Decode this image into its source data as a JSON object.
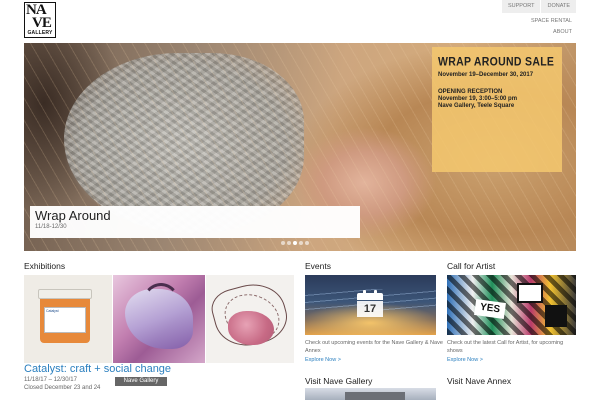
{
  "header": {
    "logo": {
      "big_top": "NA",
      "big_bottom": "VE",
      "small": "GALLERY"
    },
    "nav": {
      "support": "SUPPORT",
      "donate": "DONATE",
      "space_rental": "SPACE RENTAL",
      "about": "ABOUT"
    }
  },
  "hero": {
    "sale": {
      "title": "WRAP AROUND SALE",
      "dates": "November 19–December 30, 2017",
      "reception_heading": "OPENING RECEPTION",
      "reception_time": "November 19, 3:00–5:00 pm",
      "reception_place": "Nave Gallery, Teele Square"
    },
    "caption": {
      "title": "Wrap Around",
      "dates": "11/18-12/30"
    },
    "slides": 5,
    "active_slide": 3
  },
  "exhibitions": {
    "heading": "Exhibitions",
    "bottle_label": "Catalyst",
    "title": "Catalyst: craft + social change",
    "dates": "11/18/17 – 12/30/17",
    "closed": "Closed December 23 and 24",
    "badge": "Nave Gallery"
  },
  "events": {
    "heading": "Events",
    "calendar_day": "17",
    "desc": "Check out upcoming events for the Nave Gallery & Nave Annex",
    "link": "Explore Now >"
  },
  "call_for_artist": {
    "heading": "Call for Artist",
    "sign": "YES",
    "desc": "Check out the latest Call for Artist, for upcoming shows",
    "link": "Explore Now >"
  },
  "visit_gallery": {
    "heading": "Visit Nave Gallery"
  },
  "visit_annex": {
    "heading": "Visit Nave Annex"
  },
  "colors": {
    "link": "#2a7fbf",
    "badge": "#666666",
    "sale_panel": "#f5c86e"
  }
}
